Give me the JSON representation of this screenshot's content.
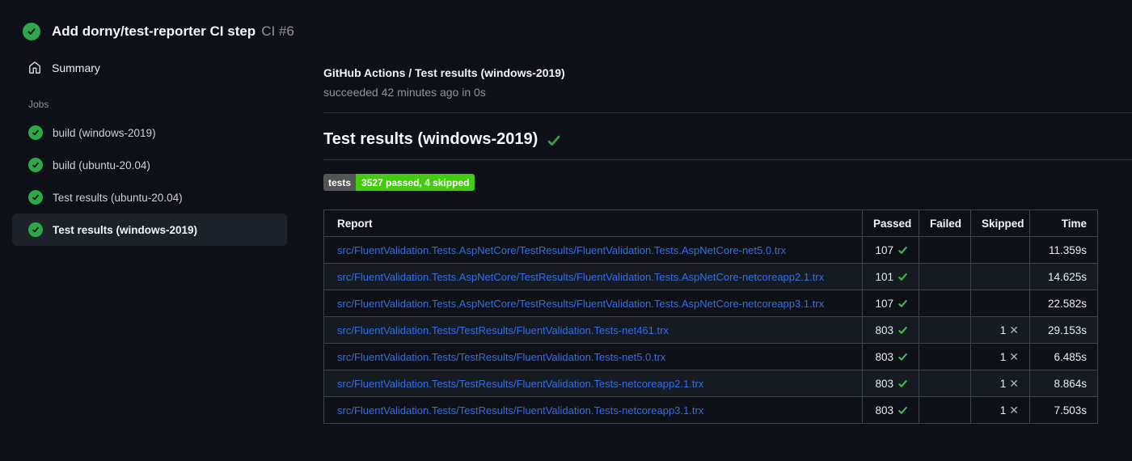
{
  "header": {
    "title": "Add dorny/test-reporter CI step",
    "run_number": "CI #6"
  },
  "sidebar": {
    "summary_label": "Summary",
    "jobs_label": "Jobs",
    "jobs": [
      {
        "label": "build (windows-2019)",
        "status": "success",
        "selected": false
      },
      {
        "label": "build (ubuntu-20.04)",
        "status": "success",
        "selected": false
      },
      {
        "label": "Test results (ubuntu-20.04)",
        "status": "success",
        "selected": false
      },
      {
        "label": "Test results (windows-2019)",
        "status": "success",
        "selected": true
      }
    ]
  },
  "main": {
    "check_title": "GitHub Actions / Test results (windows-2019)",
    "check_status": "succeeded 42 minutes ago in 0s",
    "section_title": "Test results (windows-2019)",
    "badge": {
      "label": "tests",
      "value": "3527 passed, 4 skipped",
      "label_bg": "#555555",
      "value_bg": "#44cc11"
    },
    "table": {
      "columns": [
        "Report",
        "Passed",
        "Failed",
        "Skipped",
        "Time"
      ],
      "rows": [
        {
          "report": "src/FluentValidation.Tests.AspNetCore/TestResults/FluentValidation.Tests.AspNetCore-net5.0.trx",
          "passed": "107",
          "failed": "",
          "skipped": "",
          "time": "11.359s"
        },
        {
          "report": "src/FluentValidation.Tests.AspNetCore/TestResults/FluentValidation.Tests.AspNetCore-netcoreapp2.1.trx",
          "passed": "101",
          "failed": "",
          "skipped": "",
          "time": "14.625s"
        },
        {
          "report": "src/FluentValidation.Tests.AspNetCore/TestResults/FluentValidation.Tests.AspNetCore-netcoreapp3.1.trx",
          "passed": "107",
          "failed": "",
          "skipped": "",
          "time": "22.582s"
        },
        {
          "report": "src/FluentValidation.Tests/TestResults/FluentValidation.Tests-net461.trx",
          "passed": "803",
          "failed": "",
          "skipped": "1",
          "time": "29.153s"
        },
        {
          "report": "src/FluentValidation.Tests/TestResults/FluentValidation.Tests-net5.0.trx",
          "passed": "803",
          "failed": "",
          "skipped": "1",
          "time": "6.485s"
        },
        {
          "report": "src/FluentValidation.Tests/TestResults/FluentValidation.Tests-netcoreapp2.1.trx",
          "passed": "803",
          "failed": "",
          "skipped": "1",
          "time": "8.864s"
        },
        {
          "report": "src/FluentValidation.Tests/TestResults/FluentValidation.Tests-netcoreapp3.1.trx",
          "passed": "803",
          "failed": "",
          "skipped": "1",
          "time": "7.503s"
        }
      ]
    }
  },
  "colors": {
    "background": "#0d1117",
    "success_green": "#2ea64a",
    "check_green": "#3fb950",
    "link_blue": "#2f6feb",
    "muted_text": "#8b949e",
    "table_border": "#3d444d",
    "row_alt": "#161b22",
    "selected_item_bg": "#1c212a"
  }
}
